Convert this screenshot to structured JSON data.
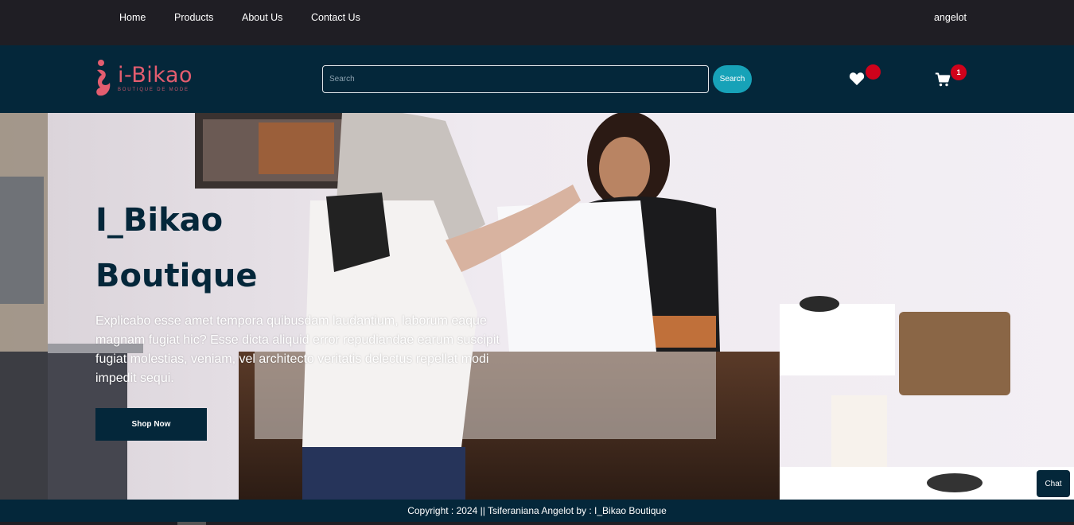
{
  "topnav": {
    "links": [
      "Home",
      "Products",
      "About Us",
      "Contact Us"
    ],
    "user": "angelot"
  },
  "header": {
    "logo": {
      "brand": "i-Bikao",
      "tagline": "BOUTIQUE DE MODE",
      "icon": "logo-figure-icon"
    },
    "search": {
      "placeholder": "Search",
      "value": "",
      "button_label": "Search"
    },
    "wishlist": {
      "icon": "heart-icon",
      "count": ""
    },
    "cart": {
      "icon": "shopping-cart-icon",
      "count": "1"
    }
  },
  "hero": {
    "title_line1": "I_Bikao",
    "title_line2": "Boutique",
    "description": "Explicabo esse amet tempora quibusdam laudantium, laborum eaque magnam fugiat hic? Esse dicta aliquid error repudiandae earum suscipit fugiat molestias, veniam, vel architecto veritatis delectus repellat modi impedit sequi.",
    "cta_label": "Shop Now"
  },
  "chat": {
    "label": "Chat"
  },
  "footer": {
    "text": "Copyright : 2024 || Tsiferaniana Angelot by : I_Bikao Boutique"
  },
  "colors": {
    "navy": "#04273a",
    "dark": "#1f1e24",
    "accent": "#17a2b8",
    "badge": "#d0021b",
    "brand": "#e35d6f"
  }
}
